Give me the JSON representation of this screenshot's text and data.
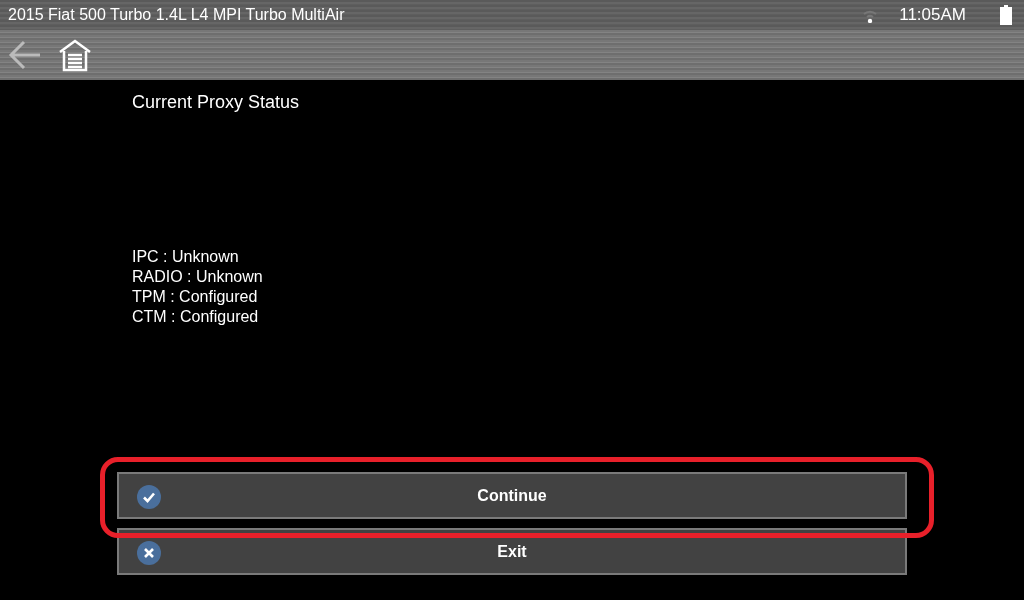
{
  "status_bar": {
    "vehicle": "2015 Fiat 500 Turbo 1.4L L4 MPI Turbo MultiAir",
    "time": "11:05AM"
  },
  "page": {
    "title": "Current Proxy Status",
    "lines": [
      "IPC : Unknown",
      "RADIO : Unknown",
      "TPM : Configured",
      "CTM : Configured"
    ]
  },
  "buttons": [
    {
      "label": "Continue",
      "kind": "check",
      "highlighted": true
    },
    {
      "label": "Exit",
      "kind": "close",
      "highlighted": false
    }
  ]
}
